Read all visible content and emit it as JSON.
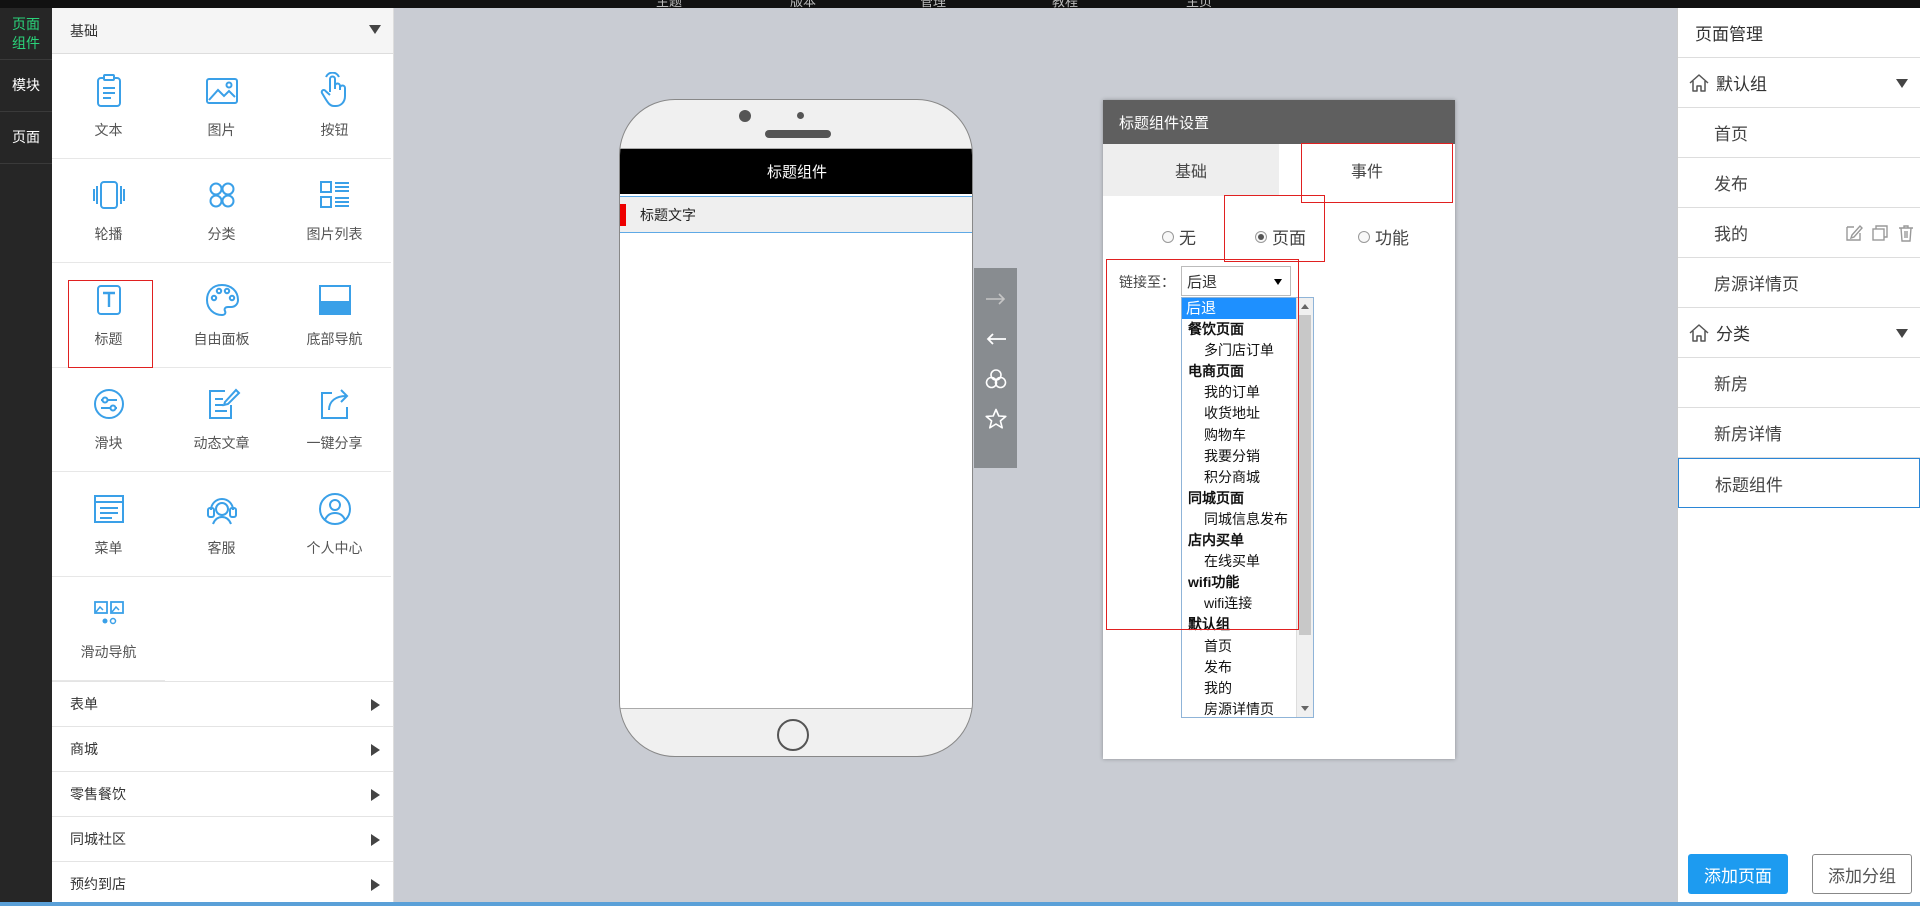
{
  "topbar": {
    "items": [
      "主题",
      "版本",
      "管理",
      "教程",
      "主页"
    ]
  },
  "rail": {
    "items": [
      "页面组件",
      "模块",
      "页面"
    ]
  },
  "components": {
    "section_title": "基础",
    "tiles": [
      {
        "label": "文本",
        "icon": "clipboard-icon"
      },
      {
        "label": "图片",
        "icon": "image-icon"
      },
      {
        "label": "按钮",
        "icon": "hand-pointer-icon"
      },
      {
        "label": "轮播",
        "icon": "carousel-icon"
      },
      {
        "label": "分类",
        "icon": "category-icon"
      },
      {
        "label": "图片列表",
        "icon": "image-list-icon"
      },
      {
        "label": "标题",
        "icon": "title-icon"
      },
      {
        "label": "自由面板",
        "icon": "palette-icon"
      },
      {
        "label": "底部导航",
        "icon": "bottom-nav-icon"
      },
      {
        "label": "滑块",
        "icon": "slider-icon"
      },
      {
        "label": "动态文章",
        "icon": "article-edit-icon"
      },
      {
        "label": "一键分享",
        "icon": "share-icon"
      },
      {
        "label": "菜单",
        "icon": "menu-icon"
      },
      {
        "label": "客服",
        "icon": "headset-icon"
      },
      {
        "label": "个人中心",
        "icon": "user-icon"
      },
      {
        "label": "滑动导航",
        "icon": "slide-nav-icon"
      }
    ],
    "categories": [
      "表单",
      "商城",
      "零售餐饮",
      "同城社区",
      "预约到店"
    ]
  },
  "phone": {
    "nav_title": "标题组件",
    "title_text": "标题文字"
  },
  "settings": {
    "header": "标题组件设置",
    "tabs": [
      "基础",
      "事件"
    ],
    "radios": [
      "无",
      "页面",
      "功能"
    ],
    "selected_radio": "页面",
    "link_label": "链接至：",
    "select_value": "后退",
    "options": [
      {
        "text": "后退",
        "type": "selected"
      },
      {
        "text": "餐饮页面",
        "type": "group"
      },
      {
        "text": "多门店订单",
        "type": "item"
      },
      {
        "text": "电商页面",
        "type": "group"
      },
      {
        "text": "我的订单",
        "type": "item"
      },
      {
        "text": "收货地址",
        "type": "item"
      },
      {
        "text": "购物车",
        "type": "item"
      },
      {
        "text": "我要分销",
        "type": "item"
      },
      {
        "text": "积分商城",
        "type": "item"
      },
      {
        "text": "同城页面",
        "type": "group"
      },
      {
        "text": "同城信息发布",
        "type": "item"
      },
      {
        "text": "店内买单",
        "type": "group"
      },
      {
        "text": "在线买单",
        "type": "item"
      },
      {
        "text": "wifi功能",
        "type": "group"
      },
      {
        "text": "wifi连接",
        "type": "item"
      },
      {
        "text": "默认组",
        "type": "group"
      },
      {
        "text": "首页",
        "type": "item"
      },
      {
        "text": "发布",
        "type": "item"
      },
      {
        "text": "我的",
        "type": "item"
      },
      {
        "text": "房源详情页",
        "type": "item"
      }
    ]
  },
  "pages": {
    "title": "页面管理",
    "groups": [
      {
        "name": "默认组",
        "pages": [
          "首页",
          "发布",
          "我的",
          "房源详情页"
        ]
      },
      {
        "name": "分类",
        "pages": [
          "新房",
          "新房详情",
          "标题组件"
        ]
      }
    ],
    "add_page": "添加页面",
    "add_group": "添加分组"
  },
  "colors": {
    "accent": "#1d9bf0",
    "icon_blue": "#3aa0e8",
    "highlight_red": "#e02020",
    "rail_active": "#2ad37a"
  }
}
